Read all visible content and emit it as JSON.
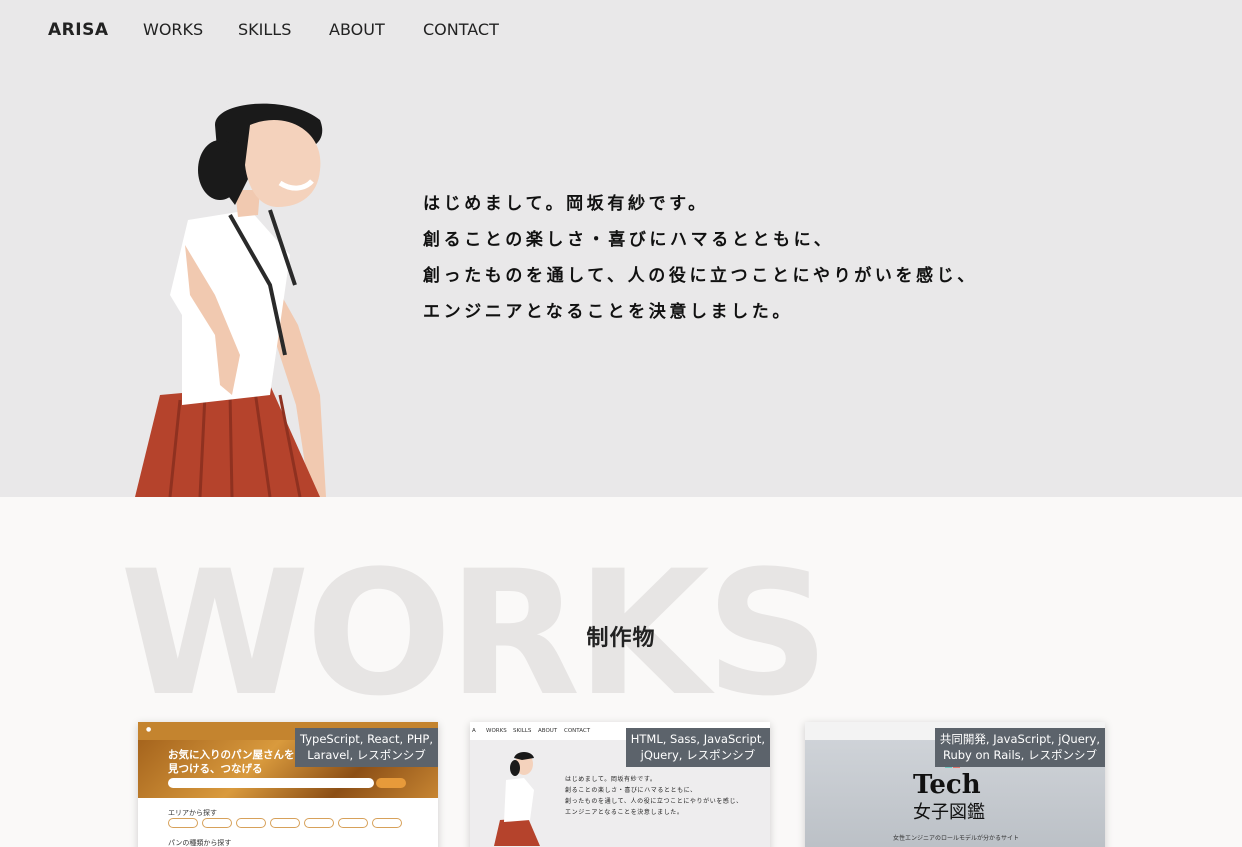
{
  "header": {
    "brand": "ARISA",
    "nav": [
      "WORKS",
      "SKILLS",
      "ABOUT",
      "CONTACT"
    ]
  },
  "hero": {
    "intro_lines": [
      "はじめまして。岡坂有紗です。",
      "創ることの楽しさ・喜びにハマるとともに、",
      "創ったものを通して、人の役に立つことにやりがいを感じ、",
      "エンジニアとなることを決意しました。"
    ]
  },
  "works": {
    "background_text": "WORKS",
    "title": "制作物",
    "cards": [
      {
        "tag_lines": [
          "TypeScript, React, PHP,",
          "Laravel, レスポンシブ"
        ],
        "preview": {
          "headline_lines": [
            "お気に入りのパン屋さんを",
            "見つける、つなげる"
          ],
          "section1": "エリアから探す",
          "section2": "パンの種類から探す"
        }
      },
      {
        "tag_lines": [
          "HTML, Sass, JavaScript,",
          "jQuery, レスポンシブ"
        ],
        "preview": {
          "nav": [
            "A",
            "WORKS",
            "SKILLS",
            "ABOUT",
            "CONTACT"
          ],
          "intro_lines": [
            "はじめまして。岡坂有紗です。",
            "創ることの楽しさ・喜びにハマるとともに、",
            "創ったものを通して、人の役に立つことにやりがいを感じ、",
            "エンジニアとなることを決意しました。"
          ]
        }
      },
      {
        "tag_lines": [
          "共同開発, JavaScript, jQuery,",
          "Ruby on Rails, レスポンシブ"
        ],
        "preview": {
          "logo": "Tech",
          "logo_sub": "女子図鑑",
          "caption": "女性エンジニアのロールモデルが分かるサイト"
        }
      }
    ]
  },
  "colors": {
    "hero_bg": "#e9e8e9",
    "page_bg": "#faf9f8",
    "tag_bg": "#5c636b",
    "skirt": "#b5432c"
  }
}
